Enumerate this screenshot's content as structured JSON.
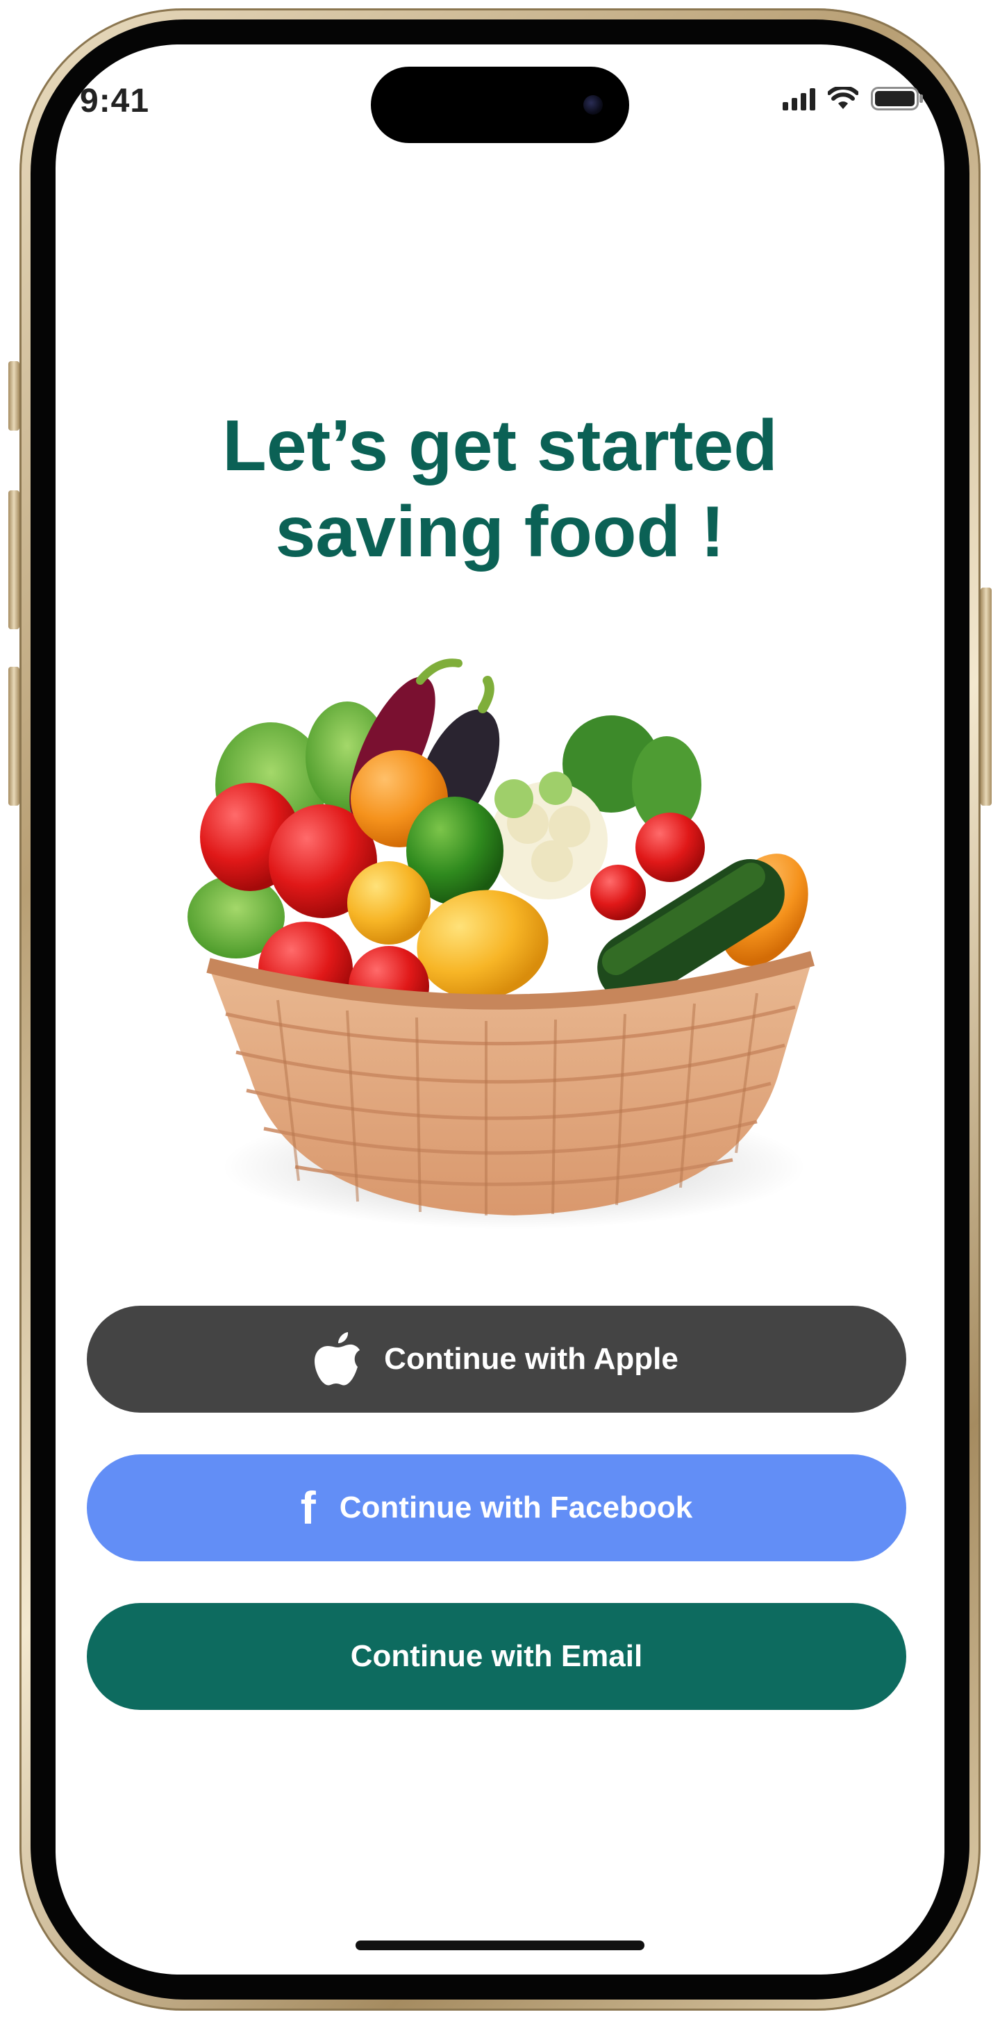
{
  "status_bar": {
    "time": "9:41",
    "icons": [
      "cellular-signal-icon",
      "wifi-icon",
      "battery-icon"
    ]
  },
  "onboarding": {
    "headline_line1": "Let’s get started",
    "headline_line2": "saving food !",
    "illustration": "vegetable-basket"
  },
  "actions": {
    "apple_label": "Continue with Apple",
    "facebook_label": "Continue with Facebook",
    "facebook_glyph": "f",
    "email_label": "Continue with Email"
  },
  "colors": {
    "headline": "#0b6155",
    "apple_button": "#444444",
    "facebook_button": "#628ef6",
    "email_button": "#0d6b5f"
  }
}
